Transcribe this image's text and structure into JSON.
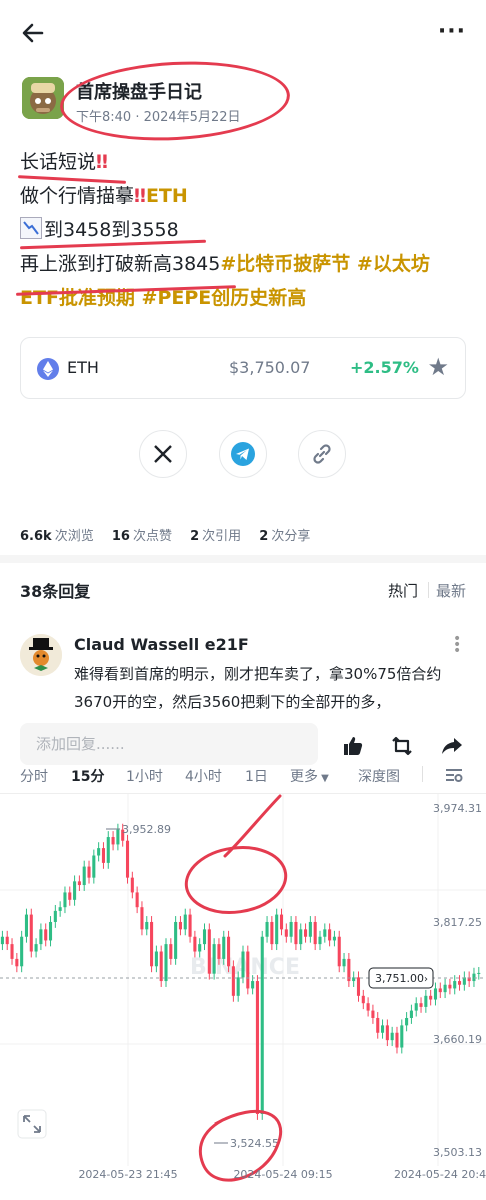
{
  "author": {
    "name": "首席操盘手日记",
    "time": "下午8:40 · 2024年5月22日"
  },
  "post": {
    "line1": "长话短说",
    "line2": "做个行情描摹",
    "line2_tag": "ETH",
    "line3": "到3458到3558",
    "line4": "再上涨到打破新高3845",
    "line4_tags": "#比特币披萨节 #以太坊",
    "line5_tags": "ETF批准预期 #PEPE创历史新高"
  },
  "coin": {
    "name": "ETH",
    "price": "$3,750.07",
    "change": "+2.57%"
  },
  "stats": {
    "views_num": "6.6k",
    "views_label": "次浏览",
    "likes_num": "16",
    "likes_label": "次点赞",
    "quotes_num": "2",
    "quotes_label": "次引用",
    "shares_num": "2",
    "shares_label": "次分享"
  },
  "replies": {
    "title": "38条回复",
    "sort_hot": "热门",
    "sort_new": "最新"
  },
  "reply": {
    "name": "Claud Wassell e21F",
    "text": "难得看到首席的明示，刚才把车卖了，拿30%75倍合约3670开的空，然后3560把剩下的全部开的多，"
  },
  "comment_bar": {
    "placeholder": "添加回复......"
  },
  "chart_tabs": {
    "t1": "分时",
    "t2": "15分",
    "t3": "1小时",
    "t4": "4小时",
    "t5": "1日",
    "t6": "更多",
    "t7": "深度图"
  },
  "chart_data": {
    "type": "candlestick",
    "y_ticks": [
      "3,974.31",
      "3,817.25",
      "3,660.19",
      "3,503.13"
    ],
    "ylim": [
      3503.13,
      3974.31
    ],
    "x_ticks": [
      "2024-05-23 21:45",
      "2024-05-24 09:15",
      "2024-05-24 20:4"
    ],
    "current_price": "3,751.00",
    "high_label": "3,952.89",
    "low_label": "3,524.55",
    "watermark": "BINANCE",
    "closes": [
      3800,
      3790,
      3770,
      3760,
      3800,
      3830,
      3780,
      3790,
      3810,
      3795,
      3820,
      3835,
      3840,
      3860,
      3850,
      3875,
      3870,
      3895,
      3880,
      3910,
      3920,
      3900,
      3935,
      3925,
      3945,
      3930,
      3880,
      3860,
      3840,
      3810,
      3820,
      3760,
      3780,
      3740,
      3790,
      3770,
      3820,
      3810,
      3830,
      3800,
      3780,
      3790,
      3810,
      3750,
      3790,
      3770,
      3800,
      3760,
      3720,
      3745,
      3780,
      3730,
      3740,
      3560,
      3800,
      3820,
      3790,
      3830,
      3810,
      3800,
      3820,
      3790,
      3810,
      3800,
      3820,
      3790,
      3800,
      3810,
      3795,
      3800,
      3760,
      3770,
      3740,
      3745,
      3720,
      3710,
      3700,
      3690,
      3670,
      3680,
      3660,
      3670,
      3650,
      3680,
      3690,
      3700,
      3710,
      3705,
      3720,
      3715,
      3730,
      3725,
      3735,
      3730,
      3740,
      3735,
      3745,
      3740,
      3750,
      3751
    ],
    "opens": [
      3790,
      3800,
      3790,
      3770,
      3760,
      3800,
      3830,
      3780,
      3790,
      3810,
      3795,
      3820,
      3835,
      3840,
      3860,
      3850,
      3875,
      3870,
      3895,
      3880,
      3910,
      3920,
      3900,
      3935,
      3925,
      3945,
      3930,
      3880,
      3860,
      3840,
      3810,
      3820,
      3760,
      3780,
      3740,
      3790,
      3770,
      3820,
      3810,
      3830,
      3800,
      3780,
      3790,
      3810,
      3750,
      3790,
      3770,
      3800,
      3760,
      3720,
      3745,
      3780,
      3730,
      3740,
      3560,
      3800,
      3820,
      3790,
      3830,
      3810,
      3800,
      3820,
      3790,
      3810,
      3800,
      3820,
      3790,
      3800,
      3810,
      3795,
      3800,
      3760,
      3770,
      3740,
      3745,
      3720,
      3710,
      3700,
      3690,
      3670,
      3680,
      3660,
      3670,
      3650,
      3680,
      3690,
      3700,
      3710,
      3705,
      3720,
      3715,
      3730,
      3725,
      3735,
      3730,
      3740,
      3735,
      3745,
      3740,
      3750
    ]
  }
}
